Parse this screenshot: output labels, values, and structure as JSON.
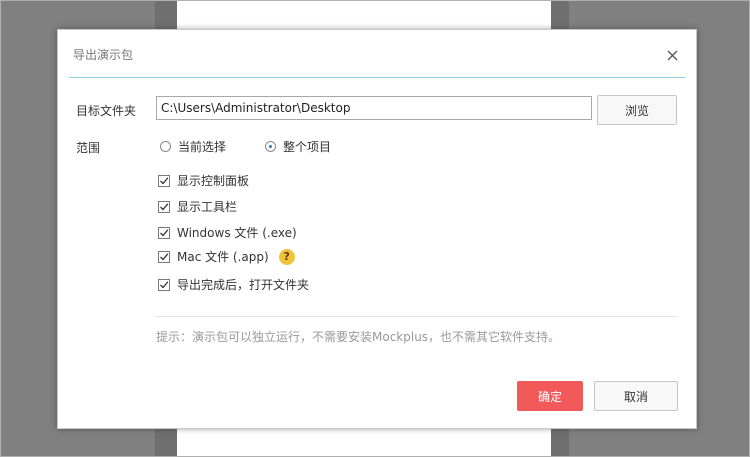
{
  "dialog": {
    "title": "导出演示包",
    "target_label": "目标文件夹",
    "target_path": "C:\\Users\\Administrator\\Desktop",
    "browse_label": "浏览",
    "range_label": "范围",
    "range_options": [
      {
        "label": "当前选择",
        "selected": false
      },
      {
        "label": "整个项目",
        "selected": true
      }
    ],
    "options": [
      {
        "label": "显示控制面板",
        "checked": true
      },
      {
        "label": "显示工具栏",
        "checked": true
      },
      {
        "label": "Windows 文件 (.exe)",
        "checked": true
      },
      {
        "label": "Mac 文件 (.app)",
        "checked": true
      },
      {
        "label": "导出完成后，打开文件夹",
        "checked": true
      }
    ],
    "help_glyph": "?",
    "hint": "提示：演示包可以独立运行，不需要安装Mockplus，也不需其它软件支持。",
    "ok_label": "确定",
    "cancel_label": "取消"
  },
  "colors": {
    "accent": "#f25a5a",
    "divider": "#8fd3e0",
    "help": "#f2c23a"
  }
}
